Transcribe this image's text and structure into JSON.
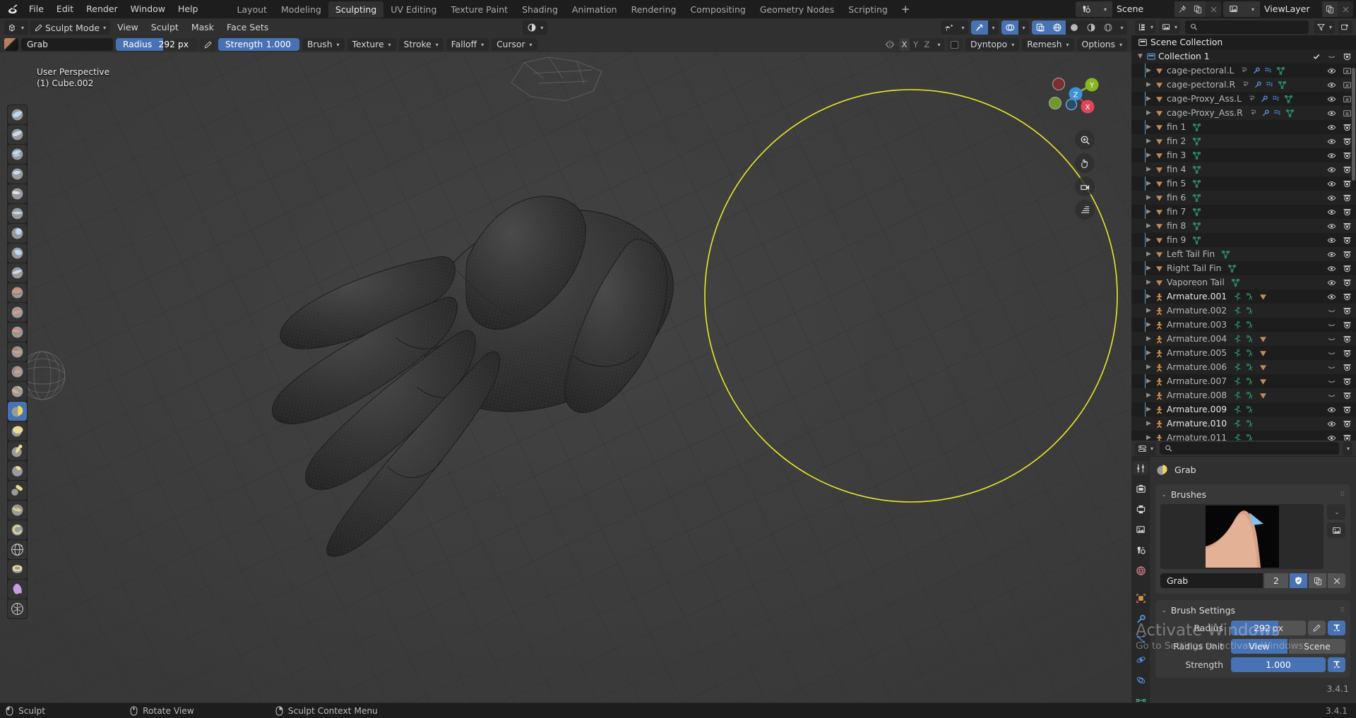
{
  "app": {
    "name": "Blender",
    "version": "3.4.1"
  },
  "topbar": {
    "logo_icon": "blender-logo-icon",
    "menus": [
      "File",
      "Edit",
      "Render",
      "Window",
      "Help"
    ],
    "workspace_tabs": [
      {
        "label": "Layout",
        "active": false
      },
      {
        "label": "Modeling",
        "active": false
      },
      {
        "label": "Sculpting",
        "active": true
      },
      {
        "label": "UV Editing",
        "active": false
      },
      {
        "label": "Texture Paint",
        "active": false
      },
      {
        "label": "Shading",
        "active": false
      },
      {
        "label": "Animation",
        "active": false
      },
      {
        "label": "Rendering",
        "active": false
      },
      {
        "label": "Compositing",
        "active": false
      },
      {
        "label": "Geometry Nodes",
        "active": false
      },
      {
        "label": "Scripting",
        "active": false
      }
    ],
    "add_workspace_label": "+",
    "scene": {
      "icon": "scene-icon",
      "name": "Scene",
      "pin_icon": "pin-icon",
      "new_icon": "duplicate-icon",
      "unlink_icon": "x-icon"
    },
    "viewlayer": {
      "icon": "viewlayer-icon",
      "name": "ViewLayer",
      "new_icon": "duplicate-icon",
      "unlink_icon": "x-icon"
    }
  },
  "viewport_header": {
    "editor_type_icon": "editor-type-3dview-icon",
    "mode": "Sculpt Mode",
    "mode_icon": "sculpt-mode-icon",
    "menus": [
      "View",
      "Sculpt",
      "Mask",
      "Face Sets"
    ],
    "mask_display_icon": "mask-sphere-icon",
    "right": {
      "visibility_icon": "object-visibility-icon",
      "gizmo_icon": "gizmo-icon",
      "overlays_icon": "overlays-icon",
      "xray_icon": "xray-icon",
      "shading_modes": [
        "wireframe",
        "solid",
        "material-preview",
        "rendered"
      ],
      "shading_active": "solid"
    }
  },
  "tool_settings": {
    "brush_preview_icon": "brush-thumbnail",
    "brush_name": "Grab",
    "radius": {
      "label": "Radius",
      "value": "292 px",
      "fill_pct": 58
    },
    "radius_pressure_icon": "pressure-icon",
    "strength": {
      "label": "Strength",
      "value": "1.000",
      "fill_pct": 100
    },
    "dropdowns": [
      "Brush",
      "Texture",
      "Stroke",
      "Falloff",
      "Cursor"
    ],
    "symmetry_icon": "symmetry-icon",
    "axes": [
      "X",
      "Y",
      "Z"
    ],
    "axes_enabled": [
      true,
      false,
      false
    ],
    "dyntopo_checkbox": false,
    "dyntopo_label": "Dyntopo",
    "remesh_label": "Remesh",
    "options_label": "Options"
  },
  "toolbar": {
    "tools": [
      {
        "name": "draw",
        "active": false
      },
      {
        "name": "draw-sharp",
        "active": false
      },
      {
        "name": "clay",
        "active": false
      },
      {
        "name": "clay-strips",
        "active": false
      },
      {
        "name": "clay-thumb",
        "active": false
      },
      {
        "name": "layer",
        "active": false
      },
      {
        "name": "inflate",
        "active": false
      },
      {
        "name": "blob",
        "active": false
      },
      {
        "name": "crease",
        "active": false
      },
      {
        "name": "smooth",
        "active": false
      },
      {
        "name": "flatten",
        "active": false
      },
      {
        "name": "fill",
        "active": false
      },
      {
        "name": "scrape",
        "active": false
      },
      {
        "name": "multiplane-scrape",
        "active": false
      },
      {
        "name": "pinch",
        "active": false
      },
      {
        "name": "grab",
        "active": true
      },
      {
        "name": "elastic-deform",
        "active": false
      },
      {
        "name": "snake-hook",
        "active": false
      },
      {
        "name": "thumb",
        "active": false
      },
      {
        "name": "pose",
        "active": false
      },
      {
        "name": "nudge",
        "active": false
      },
      {
        "name": "rotate",
        "active": false
      },
      {
        "name": "slide-relax",
        "active": false
      },
      {
        "name": "boundary",
        "active": false
      },
      {
        "name": "cloth",
        "active": false
      },
      {
        "name": "simplify",
        "active": false
      }
    ]
  },
  "viewport": {
    "perspective_label": "User Perspective",
    "active_object_label": "(1) Cube.002",
    "gizmo_axes": [
      "X",
      "Y",
      "Z"
    ],
    "cursor_radius_color": "#e8e82a",
    "side_buttons": [
      "zoom-icon",
      "pan-icon",
      "camera-icon",
      "ortho-persp-icon"
    ]
  },
  "outliner": {
    "display_mode_icon": "outliner-display-mode-icon",
    "filter_id_icon": "filter-id-icon",
    "search_placeholder": "",
    "search_value": "",
    "filter_icon": "funnel-icon",
    "new_collection_icon": "new-collection-icon",
    "root": {
      "label": "Scene Collection",
      "icon": "scene-collection-icon"
    },
    "collection": {
      "label": "Collection 1",
      "icon": "collection-icon",
      "checkbox": true,
      "exclude_icon": "holdout-icon",
      "render_icon": "camera-icon"
    },
    "rows": [
      {
        "label": "cage-pectoral.L",
        "icon": "mesh-triangle-icon",
        "mods": [
          "constraint-icon",
          "modifier-icon",
          "particles-icon",
          "mesh-data-icon"
        ],
        "bright": false,
        "visible_icon": "eye-icon",
        "render_icon": "camera-off-icon"
      },
      {
        "label": "cage-pectoral.R",
        "icon": "mesh-triangle-icon",
        "mods": [
          "constraint-icon",
          "modifier-icon",
          "particles-icon",
          "mesh-data-icon"
        ],
        "bright": false,
        "visible_icon": "eye-icon",
        "render_icon": "camera-off-icon"
      },
      {
        "label": "cage-Proxy_Ass.L",
        "icon": "mesh-triangle-icon",
        "mods": [
          "constraint-icon",
          "modifier-icon",
          "particles-icon",
          "mesh-data-icon"
        ],
        "bright": false,
        "visible_icon": "eye-icon",
        "render_icon": "camera-off-icon"
      },
      {
        "label": "cage-Proxy_Ass.R",
        "icon": "mesh-triangle-icon",
        "mods": [
          "constraint-icon",
          "modifier-icon",
          "particles-icon",
          "mesh-data-icon"
        ],
        "bright": false,
        "visible_icon": "eye-icon",
        "render_icon": "camera-off-icon"
      },
      {
        "label": "fin 1",
        "icon": "mesh-triangle-icon",
        "mods": [
          "mesh-data-icon"
        ],
        "bright": false,
        "visible_icon": "eye-icon",
        "render_icon": "camera-icon"
      },
      {
        "label": "fin 2",
        "icon": "mesh-triangle-icon",
        "mods": [
          "mesh-data-icon"
        ],
        "bright": false,
        "visible_icon": "eye-icon",
        "render_icon": "camera-icon"
      },
      {
        "label": "fin 3",
        "icon": "mesh-triangle-icon",
        "mods": [
          "mesh-data-icon"
        ],
        "bright": false,
        "visible_icon": "eye-icon",
        "render_icon": "camera-icon"
      },
      {
        "label": "fin 4",
        "icon": "mesh-triangle-icon",
        "mods": [
          "mesh-data-icon"
        ],
        "bright": false,
        "visible_icon": "eye-icon",
        "render_icon": "camera-icon"
      },
      {
        "label": "fin 5",
        "icon": "mesh-triangle-icon",
        "mods": [
          "mesh-data-icon"
        ],
        "bright": false,
        "visible_icon": "eye-icon",
        "render_icon": "camera-icon"
      },
      {
        "label": "fin 6",
        "icon": "mesh-triangle-icon",
        "mods": [
          "mesh-data-icon"
        ],
        "bright": false,
        "visible_icon": "eye-icon",
        "render_icon": "camera-icon"
      },
      {
        "label": "fin 7",
        "icon": "mesh-triangle-icon",
        "mods": [
          "mesh-data-icon"
        ],
        "bright": false,
        "visible_icon": "eye-icon",
        "render_icon": "camera-icon"
      },
      {
        "label": "fin 8",
        "icon": "mesh-triangle-icon",
        "mods": [
          "mesh-data-icon"
        ],
        "bright": false,
        "visible_icon": "eye-icon",
        "render_icon": "camera-icon"
      },
      {
        "label": "fin 9",
        "icon": "mesh-triangle-icon",
        "mods": [
          "mesh-data-icon"
        ],
        "bright": false,
        "visible_icon": "eye-icon",
        "render_icon": "camera-icon"
      },
      {
        "label": "Left Tail Fin",
        "icon": "mesh-triangle-icon",
        "mods": [
          "mesh-data-icon"
        ],
        "bright": false,
        "visible_icon": "eye-icon",
        "render_icon": "camera-icon"
      },
      {
        "label": "Right Tail Fin",
        "icon": "mesh-triangle-icon",
        "mods": [
          "mesh-data-icon"
        ],
        "bright": false,
        "visible_icon": "eye-icon",
        "render_icon": "camera-icon"
      },
      {
        "label": "Vaporeon Tail",
        "icon": "mesh-triangle-icon",
        "mods": [
          "mesh-data-icon"
        ],
        "bright": false,
        "visible_icon": "eye-icon",
        "render_icon": "camera-icon"
      },
      {
        "label": "Armature.001",
        "icon": "armature-icon",
        "mods": [
          "pose-icon",
          "armature-data-icon",
          "mesh-triangle-icon"
        ],
        "bright": true,
        "visible_icon": "eye-icon",
        "render_icon": "camera-icon"
      },
      {
        "label": "Armature.002",
        "icon": "armature-icon",
        "mods": [
          "pose-icon",
          "armature-data-icon"
        ],
        "bright": false,
        "visible_icon": "eye-closed-icon",
        "render_icon": "camera-icon"
      },
      {
        "label": "Armature.003",
        "icon": "armature-icon",
        "mods": [
          "pose-icon",
          "armature-data-icon"
        ],
        "bright": false,
        "visible_icon": "eye-closed-icon",
        "render_icon": "camera-icon"
      },
      {
        "label": "Armature.004",
        "icon": "armature-icon",
        "mods": [
          "pose-icon",
          "armature-data-icon",
          "mesh-triangle-icon"
        ],
        "bright": false,
        "visible_icon": "eye-closed-icon",
        "render_icon": "camera-icon"
      },
      {
        "label": "Armature.005",
        "icon": "armature-icon",
        "mods": [
          "pose-icon",
          "armature-data-icon",
          "mesh-triangle-icon"
        ],
        "bright": false,
        "visible_icon": "eye-closed-icon",
        "render_icon": "camera-icon"
      },
      {
        "label": "Armature.006",
        "icon": "armature-icon",
        "mods": [
          "pose-icon",
          "armature-data-icon",
          "mesh-triangle-icon"
        ],
        "bright": false,
        "visible_icon": "eye-closed-icon",
        "render_icon": "camera-icon"
      },
      {
        "label": "Armature.007",
        "icon": "armature-icon",
        "mods": [
          "pose-icon",
          "armature-data-icon",
          "mesh-triangle-icon"
        ],
        "bright": false,
        "visible_icon": "eye-closed-icon",
        "render_icon": "camera-icon"
      },
      {
        "label": "Armature.008",
        "icon": "armature-icon",
        "mods": [
          "pose-icon",
          "armature-data-icon",
          "mesh-triangle-icon"
        ],
        "bright": false,
        "visible_icon": "eye-closed-icon",
        "render_icon": "camera-icon"
      },
      {
        "label": "Armature.009",
        "icon": "armature-icon",
        "mods": [
          "pose-icon",
          "armature-data-icon"
        ],
        "bright": true,
        "visible_icon": "eye-icon",
        "render_icon": "camera-icon"
      },
      {
        "label": "Armature.010",
        "icon": "armature-icon",
        "mods": [
          "pose-icon",
          "armature-data-icon"
        ],
        "bright": true,
        "visible_icon": "eye-icon",
        "render_icon": "camera-icon"
      },
      {
        "label": "Armature.011",
        "icon": "armature-icon",
        "mods": [
          "pose-icon",
          "armature-data-icon"
        ],
        "bright": false,
        "visible_icon": "eye-icon",
        "render_icon": "camera-icon"
      }
    ]
  },
  "properties": {
    "editor_icon": "properties-editor-icon",
    "search_placeholder": "",
    "tabs": [
      {
        "name": "tool",
        "selected": true
      },
      {
        "name": "render",
        "selected": false
      },
      {
        "name": "output",
        "selected": false
      },
      {
        "name": "view-layer",
        "selected": false
      },
      {
        "name": "scene",
        "selected": false
      },
      {
        "name": "world",
        "selected": false
      },
      {
        "name": "object",
        "selected": false
      },
      {
        "name": "modifiers",
        "selected": false
      },
      {
        "name": "particles",
        "selected": false
      },
      {
        "name": "physics",
        "selected": false
      },
      {
        "name": "constraints",
        "selected": false
      },
      {
        "name": "object-data",
        "selected": false
      }
    ],
    "context_title": "Grab",
    "context_icon": "grab-brush-icon",
    "brushes_panel": {
      "label": "Brushes",
      "brush_name": "Grab",
      "users": "2",
      "fake_user_icon": "shield-icon",
      "duplicate_icon": "duplicate-icon",
      "unlink_icon": "x-icon"
    },
    "brush_settings_panel": {
      "label": "Brush Settings",
      "radius_label": "Radius",
      "radius_value": "292",
      "radius_unit_suffix": "px",
      "radius_pressure_icon": "pressure-icon",
      "radius_anim_icon": "animate-icon",
      "radius_unit_label": "Radius Unit",
      "radius_unit_options": [
        "View",
        "Scene"
      ],
      "radius_unit_selected": "View",
      "strength_label": "Strength",
      "strength_value": "1.000",
      "strength_anim_icon": "animate-icon"
    }
  },
  "watermark": {
    "line1": "Activate Windows",
    "line2": "Go to Settings to activate Windows."
  },
  "statusbar": {
    "items": [
      {
        "icon": "mouse-left-icon",
        "label": "Sculpt"
      },
      {
        "icon": "mouse-middle-icon",
        "label": "Rotate View"
      },
      {
        "icon": "mouse-right-icon",
        "label": "Sculpt Context Menu"
      }
    ],
    "version": "3.4.1"
  }
}
